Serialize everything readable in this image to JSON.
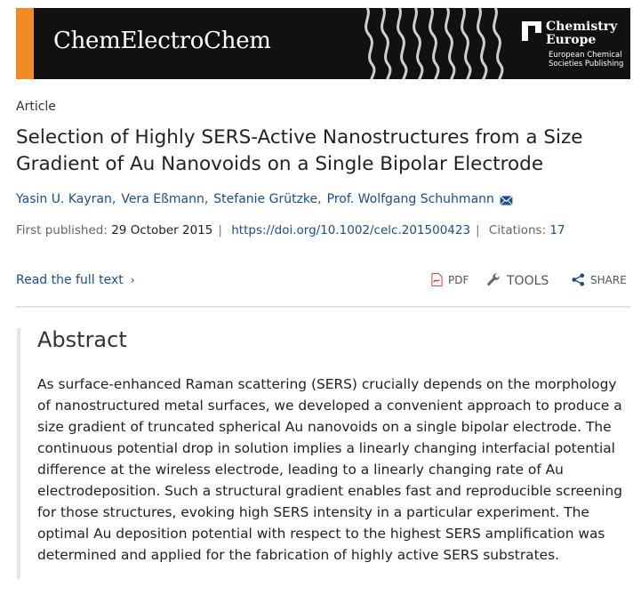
{
  "banner": {
    "journal_name": "ChemElectroChem",
    "publisher_name": "Chemistry Europe",
    "publisher_subtitle": "European Chemical Societies Publishing",
    "accent_color": "#f08a24"
  },
  "article_type": "Article",
  "title": "Selection of Highly SERS-Active Nanostructures from a Size Gradient of Au Nanovoids on a Single Bipolar Electrode",
  "authors": [
    {
      "name": "Yasin U. Kayran"
    },
    {
      "name": "Vera Eßmann"
    },
    {
      "name": "Stefanie Grützke"
    },
    {
      "name": "Prof. Wolfgang Schuhmann"
    }
  ],
  "pub_info": {
    "first_published_label": "First published:",
    "first_published_date": "29 October 2015",
    "doi": "https://doi.org/10.1002/celc.201500423",
    "citations_label": "Citations:",
    "citations_count": "17"
  },
  "read_full_text": "Read the full text",
  "toolbar": {
    "pdf_label": "PDF",
    "tools_label": "TOOLS",
    "share_label": "SHARE"
  },
  "abstract": {
    "heading": "Abstract",
    "text": "As surface-enhanced Raman scattering (SERS) crucially depends on the morphology of nanostructured metal surfaces, we developed a convenient approach to produce a size gradient of truncated spherical Au nanovoids on a single bipolar electrode. The continuous potential drop in solution implies a linearly changing interfacial potential difference at the wireless electrode, leading to a linearly changing rate of Au electrodeposition. Such a structural gradient enables fast and reproducible screening for those structures, evoking high SERS intensity in a particular experiment. The optimal Au deposition potential with respect to the highest SERS amplification was determined and applied for the fabrication of highly active SERS substrates."
  },
  "icons": {
    "mail": "mail-icon",
    "pdf": "pdf-icon",
    "tools": "wrench-icon",
    "share": "share-icon",
    "chevron": "chevron-right-icon"
  },
  "colors": {
    "link": "#1a4f8b",
    "banner_bg": "#111111",
    "pdf_red": "#d0312d"
  }
}
